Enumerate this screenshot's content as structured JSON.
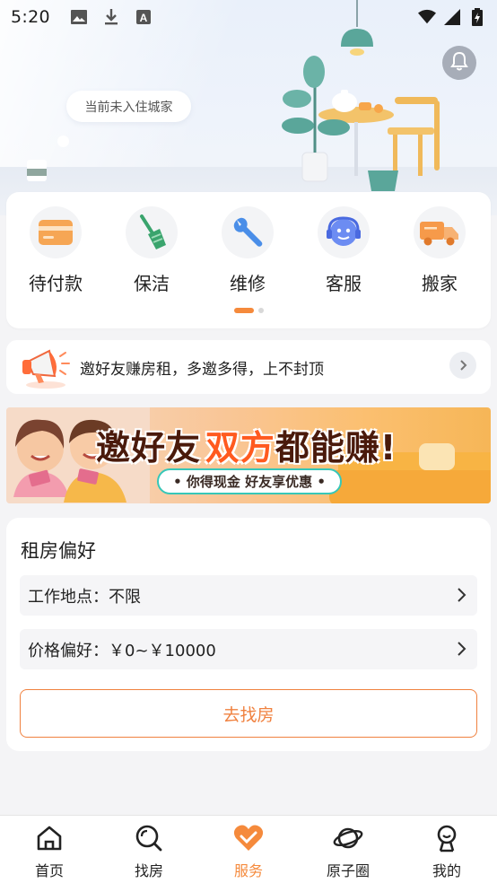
{
  "status_bar": {
    "time": "5:20",
    "left_icons": [
      "image-icon",
      "download-icon",
      "a-text-icon"
    ],
    "right_icons": [
      "wifi-icon",
      "signal-icon",
      "battery-charging-icon"
    ]
  },
  "hero": {
    "city_prompt": "当前未入住城家",
    "bell_icon": "bell-icon"
  },
  "services": {
    "items": [
      {
        "label": "待付款",
        "icon": "card-icon"
      },
      {
        "label": "保洁",
        "icon": "broom-icon"
      },
      {
        "label": "维修",
        "icon": "wrench-icon"
      },
      {
        "label": "客服",
        "icon": "headset-icon"
      },
      {
        "label": "搬家",
        "icon": "truck-icon"
      }
    ],
    "page_count": 2,
    "active_page": 1
  },
  "invite": {
    "text": "邀好友赚房租，多邀多得，上不封顶",
    "icon": "megaphone-icon"
  },
  "banner": {
    "title_part1": "邀好友",
    "title_highlight": "双方",
    "title_part2": "都能赚!",
    "subtitle": "• 你得现金 好友享优惠 •"
  },
  "preferences": {
    "title": "租房偏好",
    "work_location_label": "工作地点：",
    "work_location_value": "不限",
    "price_label": "价格偏好：",
    "price_value": "￥0~￥10000",
    "search_button": "去找房"
  },
  "tabbar": {
    "tabs": [
      {
        "label": "首页",
        "icon": "home-icon"
      },
      {
        "label": "找房",
        "icon": "search-icon"
      },
      {
        "label": "服务",
        "icon": "heart-service-icon"
      },
      {
        "label": "原子圈",
        "icon": "planet-icon"
      },
      {
        "label": "我的",
        "icon": "user-icon"
      }
    ],
    "active": "服务"
  },
  "colors": {
    "accent": "#f58a3c",
    "page_bg": "#f4f4f6",
    "card_bg": "#ffffff"
  }
}
